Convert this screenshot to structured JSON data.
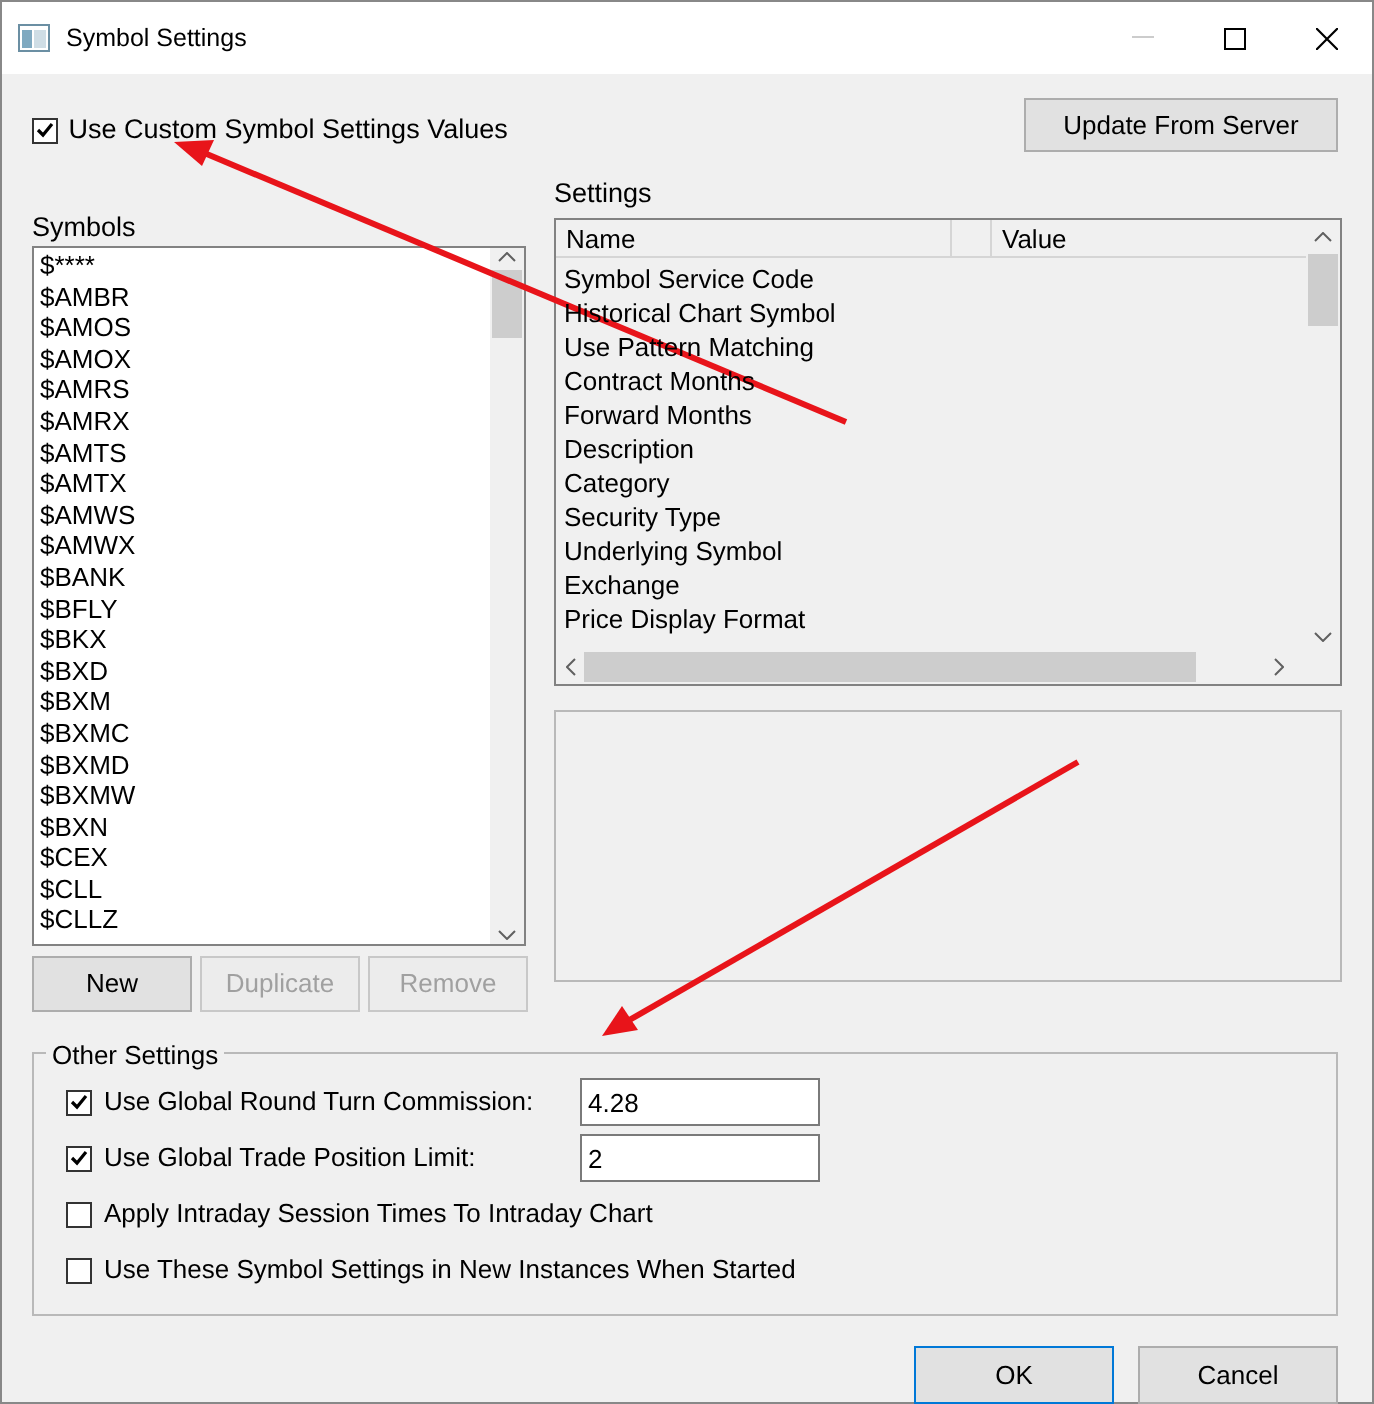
{
  "window": {
    "title": "Symbol Settings"
  },
  "use_custom": {
    "label": "Use Custom Symbol Settings Values",
    "checked": true
  },
  "update_button": {
    "label": "Update From Server"
  },
  "symbols": {
    "label": "Symbols",
    "items": [
      "$****",
      "$AMBR",
      "$AMOS",
      "$AMOX",
      "$AMRS",
      "$AMRX",
      "$AMTS",
      "$AMTX",
      "$AMWS",
      "$AMWX",
      "$BANK",
      "$BFLY",
      "$BKX",
      "$BXD",
      "$BXM",
      "$BXMC",
      "$BXMD",
      "$BXMW",
      "$BXN",
      "$CEX",
      "$CLL",
      "$CLLZ"
    ]
  },
  "symbol_buttons": [
    {
      "label": "New",
      "disabled": false
    },
    {
      "label": "Duplicate",
      "disabled": true
    },
    {
      "label": "Remove",
      "disabled": true
    }
  ],
  "settings": {
    "label": "Settings",
    "columns": [
      "Name",
      "Value"
    ],
    "rows": [
      "Symbol Service Code",
      "Historical Chart Symbol",
      "Use Pattern Matching",
      "Contract Months",
      "Forward Months",
      "Description",
      "Category",
      "Security Type",
      "Underlying Symbol",
      "Exchange",
      "Price Display Format"
    ]
  },
  "other_settings": {
    "label": "Other Settings",
    "items": [
      {
        "label": "Use Global Round Turn Commission:",
        "checked": true,
        "value": "4.28"
      },
      {
        "label": "Use Global Trade Position Limit:",
        "checked": true,
        "value": "2"
      },
      {
        "label": "Apply Intraday Session Times To Intraday Chart",
        "checked": false
      },
      {
        "label": "Use These Symbol Settings in New Instances When Started",
        "checked": false
      }
    ]
  },
  "buttons": [
    "OK",
    "Cancel"
  ]
}
